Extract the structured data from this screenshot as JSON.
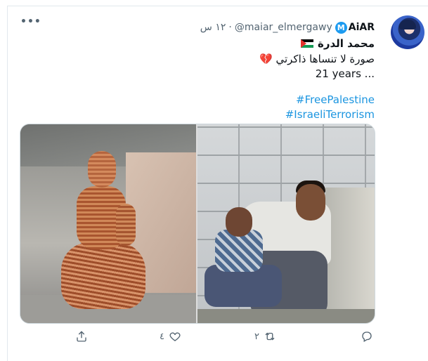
{
  "tweet": {
    "display_name": "AiAR",
    "badge_letter": "M",
    "handle": "@maiar_elmergawy",
    "time": "١٢ س",
    "dot": "·",
    "second_name": "محمد الدرة",
    "line1": "صورة لا تنساها ذاكرتي",
    "line1_emoji": "💔",
    "line2": "21 years ...",
    "hashtags": [
      "#FreePalestine",
      "#IsraeliTerrorism"
    ]
  },
  "actions": {
    "reply_count": "",
    "retweet_count": "٢",
    "like_count": "٤",
    "share_count": ""
  },
  "colors": {
    "link": "#1b95e0",
    "muted": "#536471",
    "badge": "#1d9bf0"
  },
  "icons": {
    "more": "more-dots-icon",
    "reply": "reply-icon",
    "retweet": "retweet-icon",
    "like": "heart-icon",
    "share": "share-icon"
  }
}
